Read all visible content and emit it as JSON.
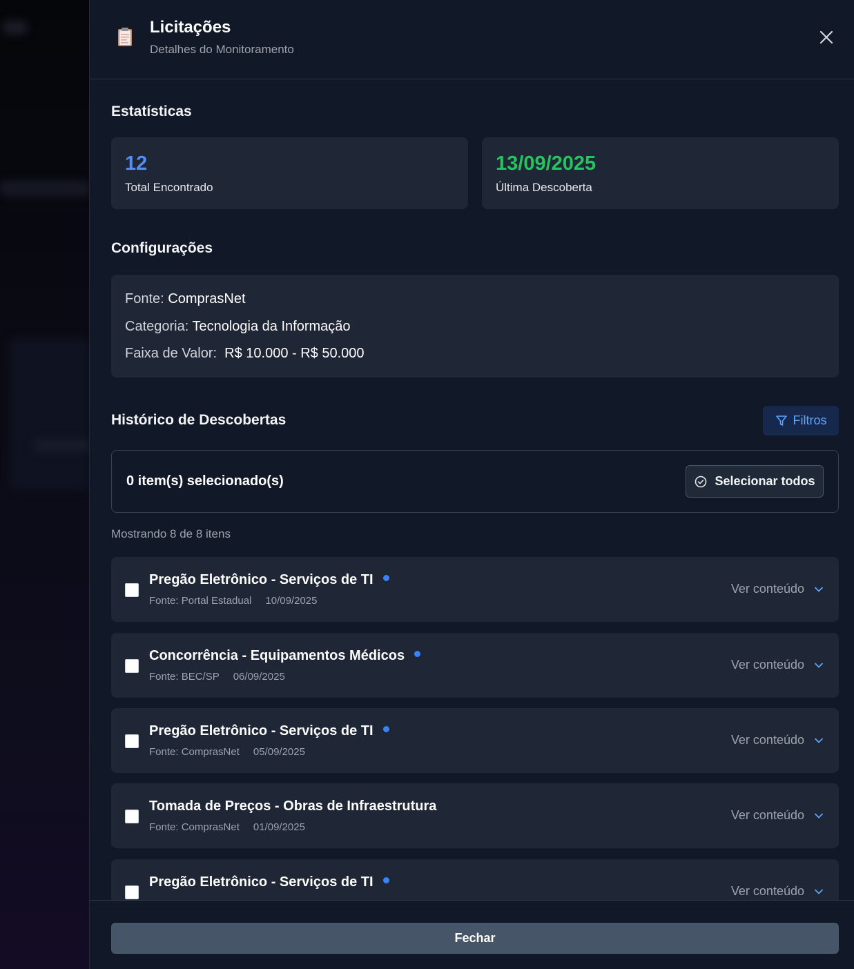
{
  "header": {
    "title": "Licitações",
    "subtitle": "Detalhes do Monitoramento",
    "icon": "clipboard-document-icon"
  },
  "stats": {
    "section_title": "Estatísticas",
    "total": {
      "value": "12",
      "label": "Total Encontrado",
      "color": "#4f8ff7"
    },
    "last": {
      "value": "13/09/2025",
      "label": "Última Descoberta",
      "color": "#22c55e"
    }
  },
  "config": {
    "section_title": "Configurações",
    "source_label": "Fonte:",
    "source_value": "ComprasNet",
    "category_label": "Categoria:",
    "category_value": "Tecnologia da Informação",
    "range_label": "Faixa de Valor:",
    "range_value": "R$ 10.000 - R$ 50.000"
  },
  "history": {
    "section_title": "Histórico de Descobertas",
    "filters_label": "Filtros",
    "selected_text": "0 item(s) selecionado(s)",
    "select_all_label": "Selecionar todos",
    "showing_text": "Mostrando 8 de 8 itens",
    "items": [
      {
        "title": "Pregão Eletrônico - Serviços de TI",
        "source": "Fonte: Portal Estadual",
        "date": "10/09/2025",
        "new": true,
        "action": "Ver conteúdo"
      },
      {
        "title": "Concorrência - Equipamentos Médicos",
        "source": "Fonte: BEC/SP",
        "date": "06/09/2025",
        "new": true,
        "action": "Ver conteúdo"
      },
      {
        "title": "Pregão Eletrônico - Serviços de TI",
        "source": "Fonte: ComprasNet",
        "date": "05/09/2025",
        "new": true,
        "action": "Ver conteúdo"
      },
      {
        "title": "Tomada de Preços - Obras de Infraestrutura",
        "source": "Fonte: ComprasNet",
        "date": "01/09/2025",
        "new": false,
        "action": "Ver conteúdo"
      },
      {
        "title": "Pregão Eletrônico - Serviços de TI",
        "source": "",
        "date": "",
        "new": true,
        "action": "Ver conteúdo"
      }
    ]
  },
  "footer": {
    "close_label": "Fechar"
  },
  "colors": {
    "accent": "#3b82f6",
    "panel": "#111827",
    "card": "#1f2635"
  }
}
